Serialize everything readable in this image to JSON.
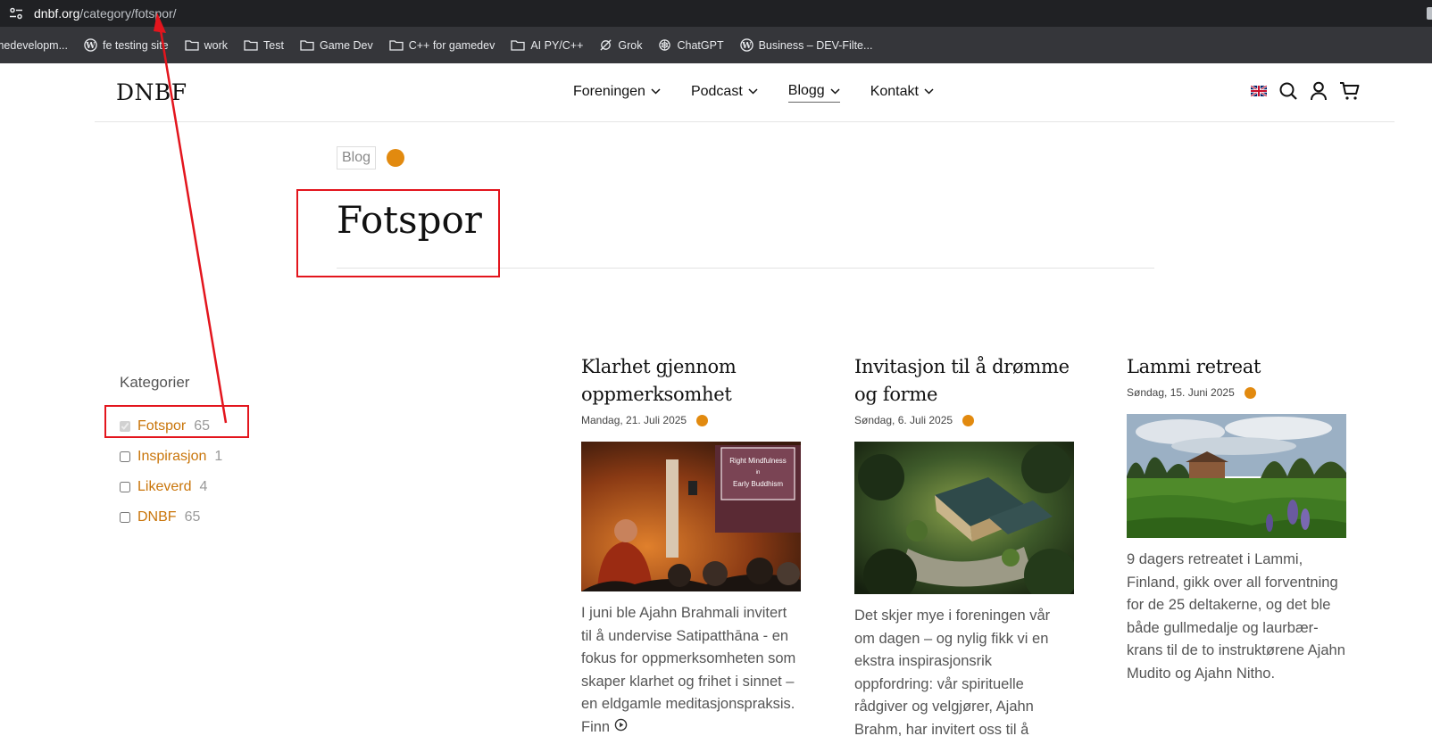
{
  "browser": {
    "url_host": "dnbf.org",
    "url_path": "/category/fotspor/",
    "bookmarks": [
      {
        "label": "medevelopm...",
        "icon": "none"
      },
      {
        "label": "fe testing site",
        "icon": "wordpress-icon"
      },
      {
        "label": "work",
        "icon": "folder-icon"
      },
      {
        "label": "Test",
        "icon": "folder-icon"
      },
      {
        "label": "Game Dev",
        "icon": "folder-icon"
      },
      {
        "label": "C++ for gamedev",
        "icon": "folder-icon"
      },
      {
        "label": "AI PY/C++",
        "icon": "folder-icon"
      },
      {
        "label": "Grok",
        "icon": "grok-icon"
      },
      {
        "label": "ChatGPT",
        "icon": "chatgpt-icon"
      },
      {
        "label": "Business – DEV-Filte...",
        "icon": "wordpress-icon"
      }
    ]
  },
  "header": {
    "logo": "DNBF",
    "nav": [
      {
        "label": "Foreningen",
        "active": false
      },
      {
        "label": "Podcast",
        "active": false
      },
      {
        "label": "Blogg",
        "active": true
      },
      {
        "label": "Kontakt",
        "active": false
      }
    ],
    "icons": [
      "uk-flag-icon",
      "search-icon",
      "account-icon",
      "cart-icon"
    ]
  },
  "category": {
    "breadcrumb": "Blog",
    "title": "Fotspor",
    "accent_color": "#e28a0f"
  },
  "sidebar": {
    "heading": "Kategorier",
    "categories": [
      {
        "name": "Fotspor",
        "count": "65",
        "checked": true
      },
      {
        "name": "Inspirasjon",
        "count": "1",
        "checked": false
      },
      {
        "name": "Likeverd",
        "count": "4",
        "checked": false
      },
      {
        "name": "DNBF",
        "count": "65",
        "checked": false
      }
    ]
  },
  "posts": [
    {
      "title": "Klarhet gjennom oppmerksomhet",
      "date": "Mandag, 21. Juli 2025",
      "slide_text": [
        "Right Mindfulness",
        "in",
        "Early Buddhism"
      ],
      "excerpt": "I juni ble Ajahn Brahmali invitert til å undervise Satipatthāna - en fokus for oppmerksomheten som skaper klarhet og frihet i sinnet – en eldgamle meditasjonspraksis. Finn"
    },
    {
      "title": "Invitasjon til å drømme og forme",
      "date": "Søndag, 6. Juli 2025",
      "excerpt": "Det skjer mye i foreningen vår om dagen – og nylig fikk vi en ekstra inspirasjonsrik oppfordring: vår spirituelle rådgiver og velgjører, Ajahn Brahm, har invitert oss til å"
    },
    {
      "title": "Lammi retreat",
      "date": "Søndag, 15. Juni 2025",
      "excerpt": "9 dagers retreatet i Lammi, Finland, gikk over all forventning for de 25 deltakerne, og det ble både gullmedalje og laurbær-krans til de to instruktørene Ajahn Mudito og Ajahn Nitho."
    }
  ]
}
